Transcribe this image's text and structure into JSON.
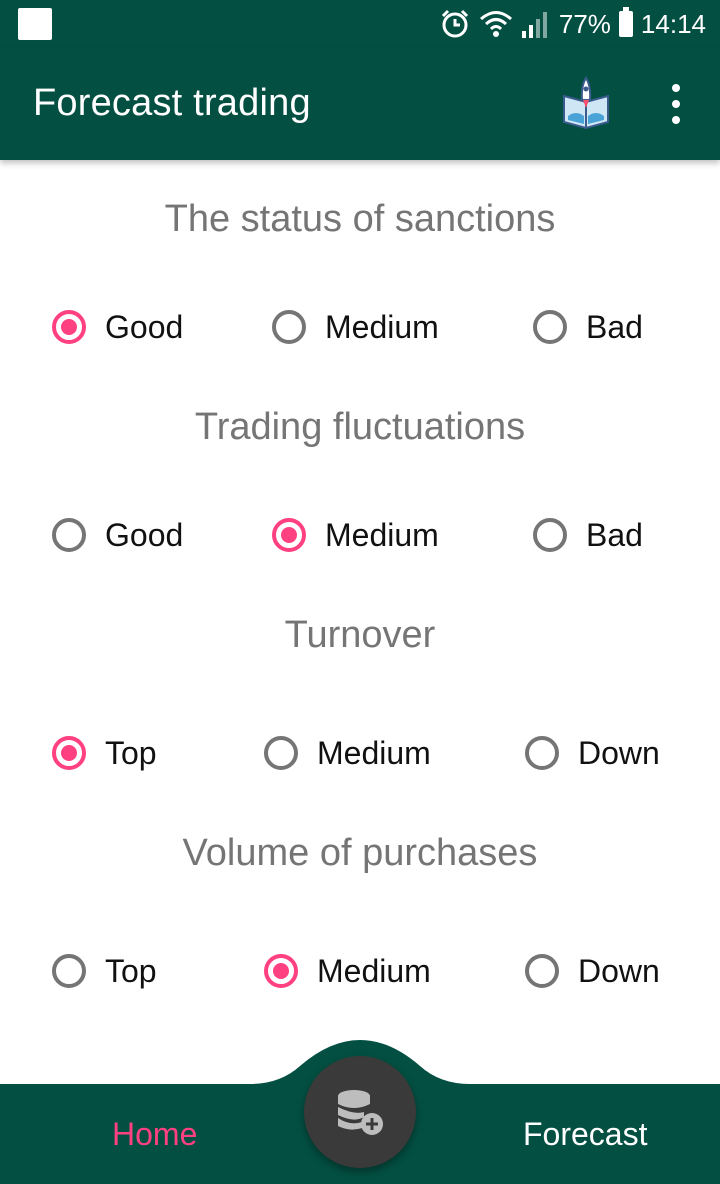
{
  "status_bar": {
    "battery": "77%",
    "time": "14:14",
    "icons": [
      "notification-square-icon",
      "alarm-icon",
      "wifi-icon",
      "signal-icon",
      "battery-icon"
    ]
  },
  "app_bar": {
    "title": "Forecast trading",
    "logo_icon": "rocket-book-logo-icon",
    "menu_icon": "more-vert-icon"
  },
  "colors": {
    "primary": "#034f42",
    "accent": "#ff4081",
    "section_title": "#757575",
    "radio_unchecked": "#757575",
    "fab": "#3a3a3a"
  },
  "sections": [
    {
      "title": "The status of sanctions",
      "options": [
        "Good",
        "Medium",
        "Bad"
      ],
      "selected": "Good"
    },
    {
      "title": "Trading fluctuations",
      "options": [
        "Good",
        "Medium",
        "Bad"
      ],
      "selected": "Medium"
    },
    {
      "title": "Turnover",
      "options": [
        "Top",
        "Medium",
        "Down"
      ],
      "selected": "Top"
    },
    {
      "title": "Volume of purchases",
      "options": [
        "Top",
        "Medium",
        "Down"
      ],
      "selected": "Medium"
    }
  ],
  "bottom_nav": {
    "home_label": "Home",
    "forecast_label": "Forecast",
    "active": "Home",
    "fab_icon": "database-add-icon"
  }
}
